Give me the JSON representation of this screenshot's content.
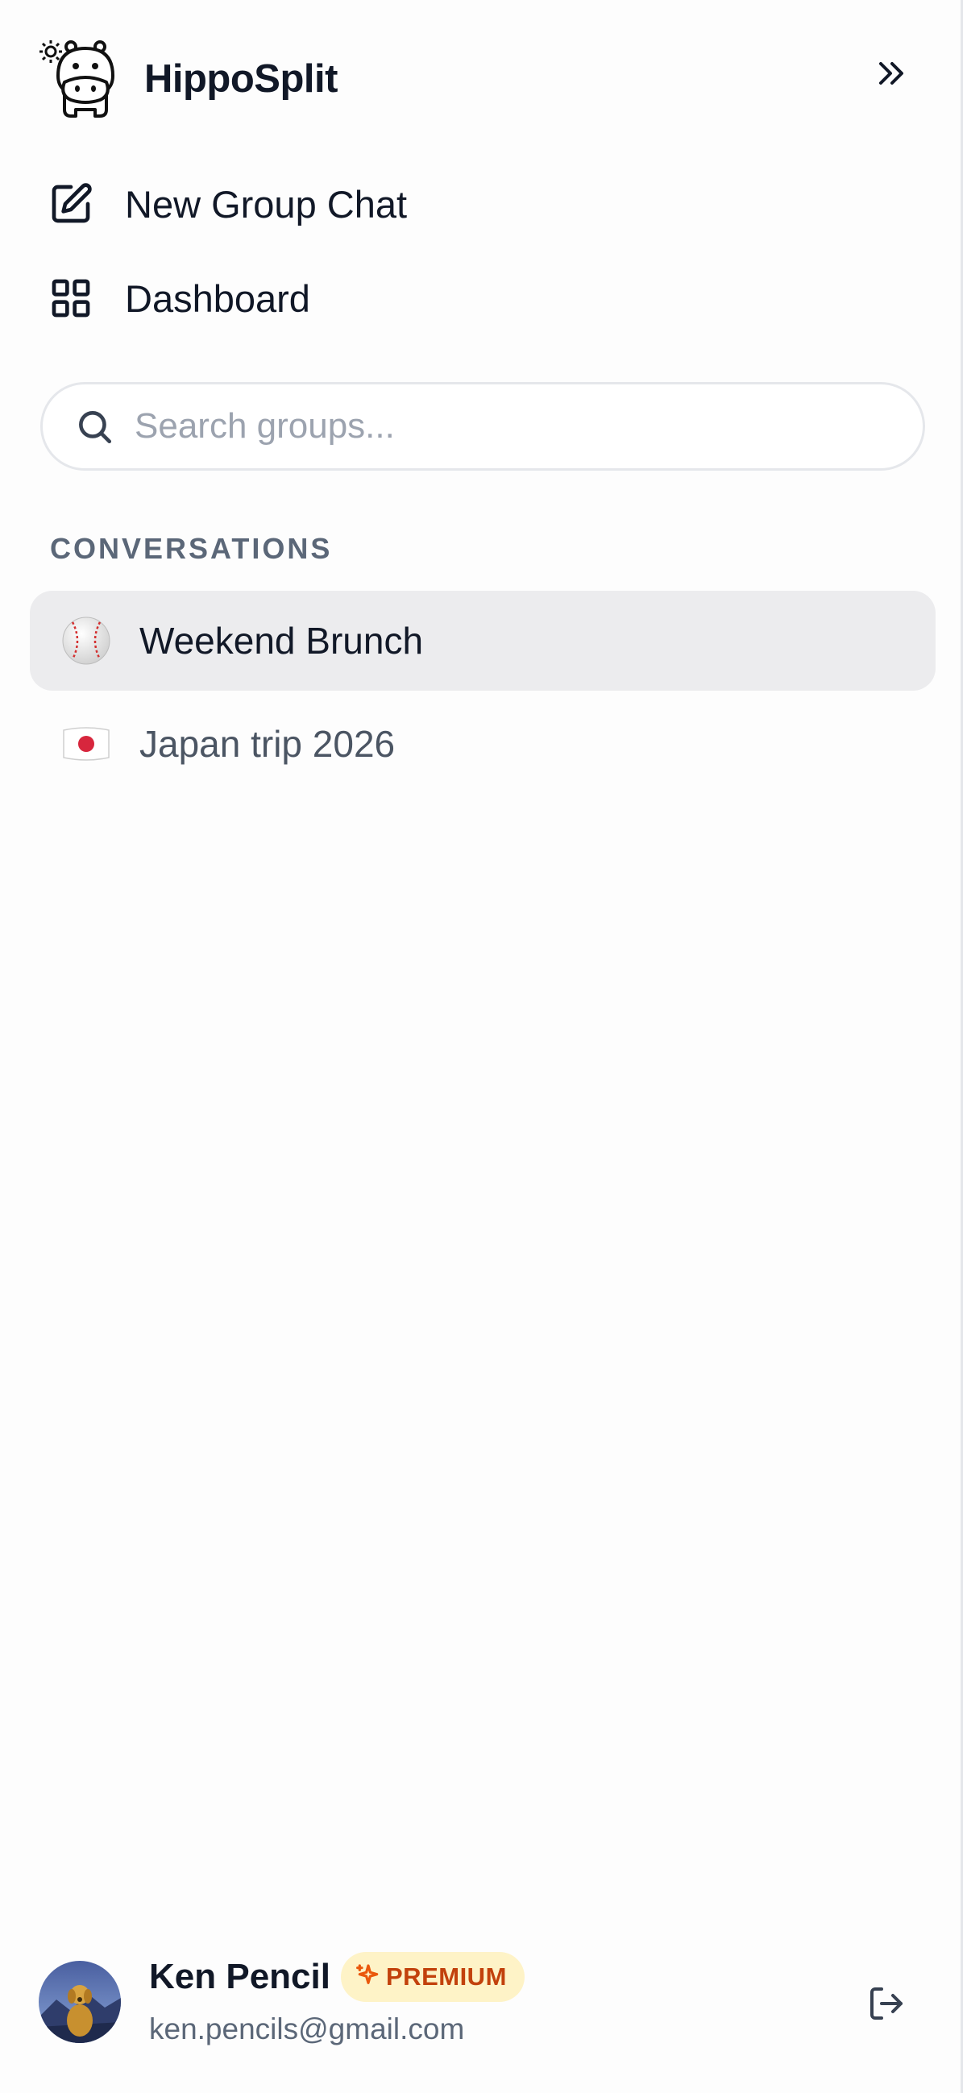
{
  "app": {
    "title": "HippoSplit",
    "collapse_icon": "chevrons-right-icon",
    "logo_icon": "hippo-logo-icon"
  },
  "nav": [
    {
      "label": "New Group Chat",
      "icon": "edit-icon"
    },
    {
      "label": "Dashboard",
      "icon": "grid-icon"
    }
  ],
  "search": {
    "placeholder": "Search groups...",
    "value": "",
    "icon": "search-icon"
  },
  "conversations": {
    "section_label": "CONVERSATIONS",
    "items": [
      {
        "label": "Weekend Brunch",
        "icon": "baseball-emoji-icon",
        "active": true
      },
      {
        "label": "Japan trip 2026",
        "icon": "japan-flag-emoji-icon",
        "active": false
      }
    ]
  },
  "user": {
    "name": "Ken Pencil",
    "badge": "PREMIUM",
    "badge_icon": "sparkle-icon",
    "email": "ken.pencils@gmail.com",
    "avatar_icon": "dog-avatar",
    "logout_icon": "logout-icon"
  },
  "colors": {
    "active_bg": "#ececee",
    "badge_bg": "#fef3c7",
    "badge_text": "#c2410c",
    "muted_text": "#5b6778"
  }
}
